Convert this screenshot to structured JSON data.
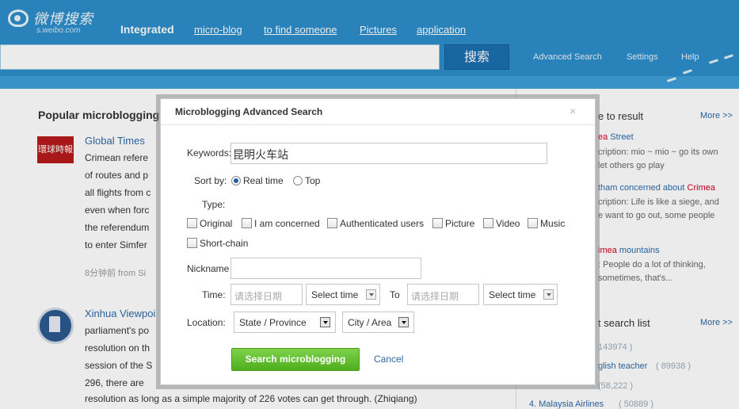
{
  "header": {
    "logo_text": "微博搜索",
    "logo_sub": "s.weibo.com",
    "nav": [
      {
        "label": "Integrated"
      },
      {
        "label": "micro-blog"
      },
      {
        "label": "to find someone"
      },
      {
        "label": "Pictures"
      },
      {
        "label": "application"
      }
    ],
    "search_button": "搜索",
    "advanced_search": "Advanced Search",
    "settings": "Settings",
    "help": "Help"
  },
  "feed": {
    "section_title": "Popular microblogging",
    "posts": [
      {
        "author": "Global Times",
        "avatar_text": "環球時報",
        "lines": [
          "Crimean refere",
          "of routes and p",
          "all flights from c",
          "even when forc",
          "the referendum",
          "to enter Simfer"
        ],
        "meta": "8分钟前  from Si"
      },
      {
        "author": "Xinhua Viewpoi",
        "lines": [
          "parliament's po",
          "resolution on th",
          "session of the S",
          "296, there are"
        ],
        "last_line": "resolution as long as a simple majority of 226 votes can get through. (Zhiqiang)"
      }
    ]
  },
  "right": {
    "result_title": "e to result",
    "more": "More >>",
    "items": [
      {
        "title_red": "ea",
        "title": " Street",
        "desc": [
          "cription: mio ~ mio ~ go its own",
          "let others go play"
        ]
      },
      {
        "title": "tham concerned about ",
        "title_red": "Crimea",
        "desc": [
          "cription: Life is like a siege, and",
          "e want to go out, some people"
        ]
      },
      {
        "title_red": "imea",
        "title": " mountains",
        "desc": [
          ":  People do a lot of thinking,",
          "sometimes, that's..."
        ]
      }
    ],
    "hot_title": "t search list",
    "hot_more": "More >>",
    "hot": [
      {
        "text": "",
        "count": "143974 )"
      },
      {
        "text": "glish teacher",
        "count": "( 89938 )"
      },
      {
        "text": "",
        "count": "(58,222 )"
      },
      {
        "text": "4.  Malaysia Airlines",
        "count": "( 50889 )"
      }
    ]
  },
  "dialog": {
    "title": "Microblogging Advanced Search",
    "close": "×",
    "keywords_label": "Keywords:",
    "keywords_value": "昆明火车站",
    "sort_label": "Sort by:",
    "sort_options": [
      "Real time",
      "Top"
    ],
    "sort_selected": "Real time",
    "type_label": "Type:",
    "types": [
      "Original",
      "I am concerned",
      "Authenticated users",
      "Picture",
      "Video",
      "Music",
      "Short-chain"
    ],
    "nickname_label": "Nickname",
    "nickname_value": "",
    "time_label": "Time:",
    "date_placeholder": "请选择日期",
    "select_time": "Select time",
    "to_label": "To",
    "location_label": "Location:",
    "state_select": "State / Province",
    "city_select": "City / Area",
    "search_button": "Search microblogging",
    "cancel": "Cancel"
  },
  "colors": {
    "header_blue": "#2d8ec9",
    "search_button": "#1b6fb0",
    "primary_green": "#5cb82a",
    "link_blue": "#2b6aa8",
    "highlight_red": "#d0021b"
  }
}
